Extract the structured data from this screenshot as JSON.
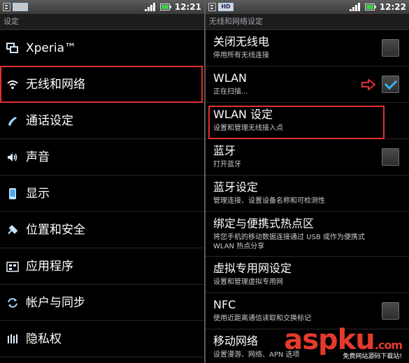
{
  "left": {
    "status": {
      "time": "12:21",
      "net": ""
    },
    "title": "设定",
    "items": [
      {
        "label": "Xperia™",
        "icon": "windows-icon"
      },
      {
        "label": "无线和网络",
        "icon": "wifi-icon"
      },
      {
        "label": "通话设定",
        "icon": "phone-icon"
      },
      {
        "label": "声音",
        "icon": "speaker-icon"
      },
      {
        "label": "显示",
        "icon": "display-icon"
      },
      {
        "label": "位置和安全",
        "icon": "wrench-icon"
      },
      {
        "label": "应用程序",
        "icon": "apps-icon"
      },
      {
        "label": "帐户与同步",
        "icon": "sync-icon"
      },
      {
        "label": "隐私权",
        "icon": "privacy-icon"
      }
    ]
  },
  "right": {
    "status": {
      "time": "12:22",
      "net": "HD"
    },
    "title": "无线和网络设定",
    "items": [
      {
        "title": "关闭无线电",
        "sub": "停用所有无线连接",
        "checkbox": false
      },
      {
        "title": "WLAN",
        "sub": "正在扫描...",
        "checkbox": true
      },
      {
        "title": "WLAN 设定",
        "sub": "设置和管理无线接入点"
      },
      {
        "title": "蓝牙",
        "sub": "打开蓝牙",
        "checkbox": false
      },
      {
        "title": "蓝牙设定",
        "sub": "管理连接、设置设备名称和可检测性"
      },
      {
        "title": "绑定与便携式热点区",
        "sub": "将您手机的移动数据连接通过 USB 或作为便携式",
        "sub2": "WLAN 热点分享"
      },
      {
        "title": "虚拟专用网设定",
        "sub": "设置和管理虚拟专用网"
      },
      {
        "title": "NFC",
        "sub": "使用近距离通信读取和交换标记",
        "checkbox": false
      },
      {
        "title": "移动网络",
        "sub": "设置漫游、网络、APN 选项"
      }
    ]
  },
  "watermark": {
    "logo": "aspku",
    "logo_suffix": ".com",
    "tagline": "免费网站源码下载站!"
  },
  "colors": {
    "highlight": "#e0302f",
    "check": "#36b4f0",
    "battery": "#3cd04a"
  }
}
